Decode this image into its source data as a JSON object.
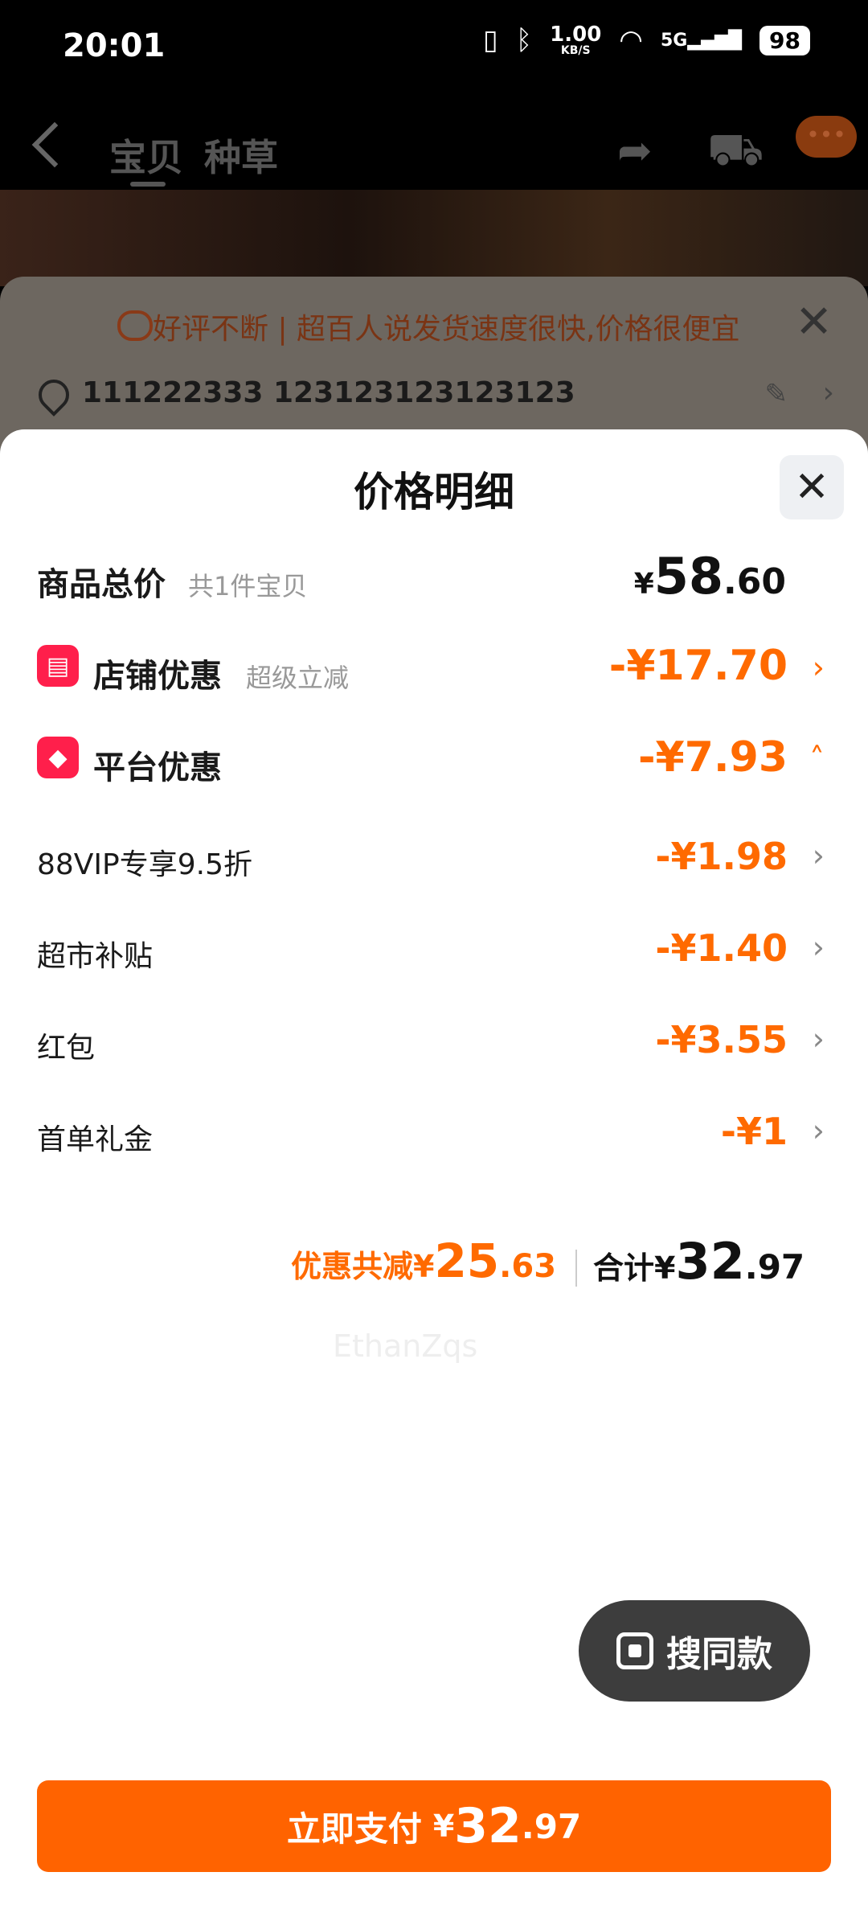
{
  "status_bar": {
    "time": "20:01",
    "net_speed_value": "1.00",
    "net_speed_unit": "KB/S",
    "signal_label": "5G",
    "battery": "98"
  },
  "nav": {
    "tabs": [
      "宝贝",
      "种草"
    ]
  },
  "background_order": {
    "banner_text": "好评不断 | 超百人说发货速度很快,价格很便宜",
    "address": "111222333 123123123123123"
  },
  "modal": {
    "title": "价格明细",
    "goods_total": {
      "label": "商品总价",
      "sub": "共1件宝贝",
      "currency": "¥",
      "int": "58",
      "dec": ".60"
    },
    "store_discount": {
      "label": "店铺优惠",
      "sub": "超级立减",
      "value": "-¥17.70"
    },
    "platform_discount": {
      "label": "平台优惠",
      "value": "-¥7.93"
    },
    "items": [
      {
        "label": "88VIP专享9.5折",
        "value": "-¥1.98"
      },
      {
        "label": "超市补贴",
        "value": "-¥1.40"
      },
      {
        "label": "红包",
        "value": "-¥3.55"
      },
      {
        "label": "首单礼金",
        "value": "-¥1"
      }
    ],
    "summary": {
      "discount_label": "优惠共减¥",
      "discount_int": "25",
      "discount_dec": ".63",
      "total_label": "合计¥",
      "total_int": "32",
      "total_dec": ".97"
    },
    "watermark": "EthanZqs",
    "search_same": "搜同款",
    "pay": {
      "label": "立即支付",
      "currency": "¥",
      "int": "32",
      "dec": ".97"
    }
  }
}
